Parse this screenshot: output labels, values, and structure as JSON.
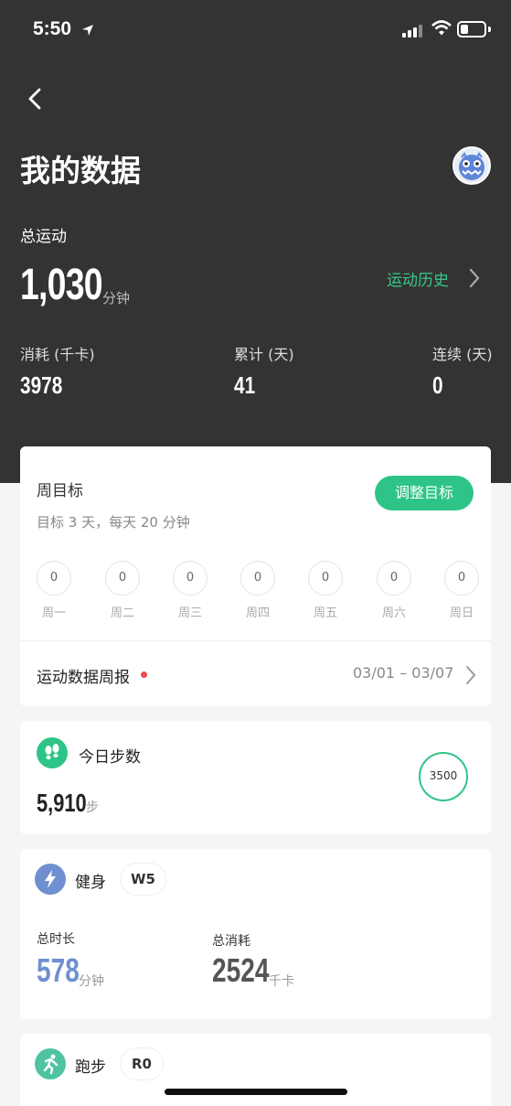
{
  "status_bar": {
    "time": "5:50"
  },
  "header": {
    "title": "我的数据",
    "total_label": "总运动",
    "total_value": "1,030",
    "total_unit": "分钟",
    "history_link": "运动历史",
    "stats": [
      {
        "label": "消耗 (千卡)",
        "value": "3978"
      },
      {
        "label": "累计 (天)",
        "value": "41"
      },
      {
        "label": "连续 (天)",
        "value": "0"
      }
    ]
  },
  "weekly_goal": {
    "title": "周目标",
    "subtitle": "目标 3 天，每天 20 分钟",
    "adjust_button": "调整目标",
    "days": [
      {
        "name": "周一",
        "value": "0"
      },
      {
        "name": "周二",
        "value": "0"
      },
      {
        "name": "周三",
        "value": "0"
      },
      {
        "name": "周四",
        "value": "0"
      },
      {
        "name": "周五",
        "value": "0"
      },
      {
        "name": "周六",
        "value": "0"
      },
      {
        "name": "周日",
        "value": "0"
      }
    ],
    "report_label": "运动数据周报",
    "report_date": "03/01 – 03/07"
  },
  "steps": {
    "title": "今日步数",
    "value": "5,910",
    "unit": "步",
    "goal": "3500"
  },
  "fitness": {
    "title": "健身",
    "tag": "W5",
    "duration_label": "总时长",
    "duration_value": "578",
    "duration_unit": "分钟",
    "calories_label": "总消耗",
    "calories_value": "2524",
    "calories_unit": "千卡"
  },
  "running": {
    "title": "跑步",
    "tag": "R0"
  },
  "colors": {
    "header_bg": "#333333",
    "accent_green": "#2ec487",
    "fitness_blue": "#6f8fd0",
    "report_dot": "#f04b4b"
  }
}
